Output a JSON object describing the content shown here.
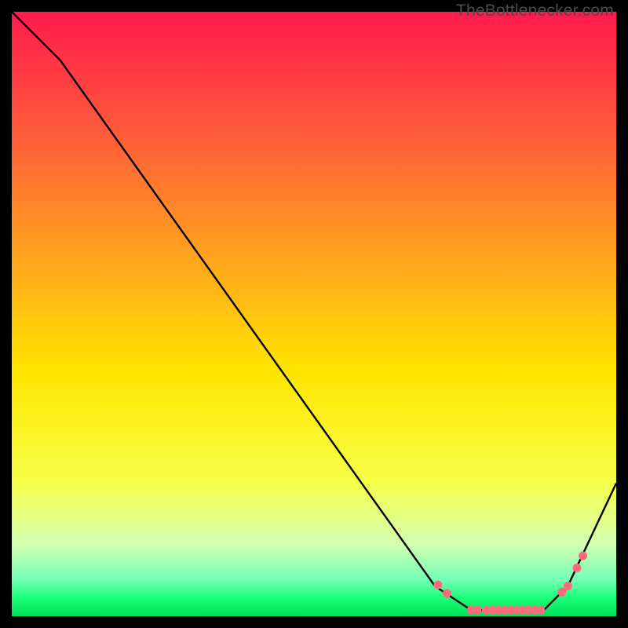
{
  "attribution": "TheBottlenecker.com",
  "chart_data": {
    "type": "line",
    "title": "",
    "xlabel": "",
    "ylabel": "",
    "xlim": [
      0,
      100
    ],
    "ylim": [
      0,
      100
    ],
    "gradient_stops": [
      {
        "offset": 0,
        "color": "#ff1a4d"
      },
      {
        "offset": 20,
        "color": "#ff5a3a"
      },
      {
        "offset": 40,
        "color": "#ffa21e"
      },
      {
        "offset": 60,
        "color": "#ffe600"
      },
      {
        "offset": 78,
        "color": "#f6ff4a"
      },
      {
        "offset": 88,
        "color": "#d4ffb0"
      },
      {
        "offset": 94,
        "color": "#72ffb6"
      },
      {
        "offset": 97,
        "color": "#1aff77"
      },
      {
        "offset": 100,
        "color": "#00e05a"
      }
    ],
    "series": [
      {
        "name": "bottleneck-curve",
        "x": [
          0,
          8,
          70,
          76,
          88,
          92,
          100
        ],
        "y": [
          100,
          92,
          5,
          1,
          1,
          5,
          22
        ]
      }
    ],
    "markers": {
      "name": "highlight-points",
      "color": "#ff6b7a",
      "x": [
        70.5,
        72,
        76,
        77,
        78.5,
        79.5,
        80.5,
        81.5,
        82.5,
        83.5,
        84.5,
        85.5,
        86.5,
        87.5,
        91,
        92,
        93.5,
        94.5
      ],
      "y": [
        5.2,
        3.8,
        1.0,
        1.0,
        1.0,
        1.0,
        1.0,
        1.0,
        1.0,
        1.0,
        1.0,
        1.0,
        1.0,
        1.0,
        4.0,
        5.0,
        8.0,
        10.0
      ]
    }
  }
}
